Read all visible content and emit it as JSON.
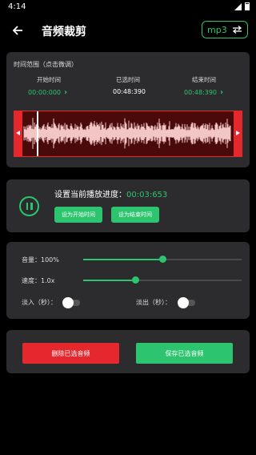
{
  "status": {
    "time": "4:14"
  },
  "header": {
    "title": "音频裁剪",
    "format": "mp3"
  },
  "range": {
    "label": "时间范围（点击微调）",
    "start_label": "开始时间",
    "selected_label": "已选时间",
    "end_label": "结束时间",
    "start_value": "00:00:000",
    "selected_value": "00:48:390",
    "end_value": "00:48:390"
  },
  "playback": {
    "prefix": "设置当前播放进度：",
    "progress": "00:03:653",
    "set_start": "设为开始时间",
    "set_end": "设为结束时间"
  },
  "settings": {
    "volume_label": "音量：100%",
    "volume_level": 0.5,
    "speed_label": "速度：1.0x",
    "speed_level": 0.33,
    "fade_in_label": "淡入（秒）：",
    "fade_out_label": "淡出（秒）："
  },
  "actions": {
    "delete": "删除已选音频",
    "save": "保存已选音频"
  },
  "colors": {
    "accent": "#2cc46e",
    "danger": "#e4282d",
    "card": "#2c2c2e"
  },
  "icons": {
    "back": "arrow-left-icon",
    "swap": "swap-arrows-icon",
    "pause": "pause-icon",
    "chevron": "chevron-right-icon"
  }
}
